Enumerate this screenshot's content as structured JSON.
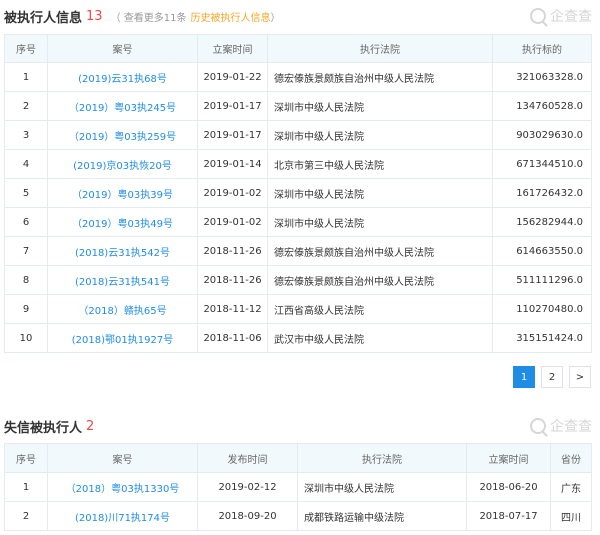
{
  "executed_section": {
    "title": "被执行人信息",
    "count": "13",
    "note_prefix": "（ 查看更多11条",
    "history_link": "历史被执行人信息",
    "note_suffix": "）",
    "watermark": "企查查",
    "headers": [
      "序号",
      "案号",
      "立案时间",
      "执行法院",
      "执行标的"
    ],
    "rows": [
      {
        "no": "1",
        "case": "(2019)云31执68号",
        "date": "2019-01-22",
        "court": "德宏傣族景颇族自治州中级人民法院",
        "amount": "321063328.0"
      },
      {
        "no": "2",
        "case": "（2019）粤03执245号",
        "date": "2019-01-17",
        "court": "深圳市中级人民法院",
        "amount": "134760528.0"
      },
      {
        "no": "3",
        "case": "（2019）粤03执259号",
        "date": "2019-01-17",
        "court": "深圳市中级人民法院",
        "amount": "903029630.0"
      },
      {
        "no": "4",
        "case": "(2019)京03执恢20号",
        "date": "2019-01-14",
        "court": "北京市第三中级人民法院",
        "amount": "671344510.0"
      },
      {
        "no": "5",
        "case": "（2019）粤03执39号",
        "date": "2019-01-02",
        "court": "深圳市中级人民法院",
        "amount": "161726432.0"
      },
      {
        "no": "6",
        "case": "（2019）粤03执49号",
        "date": "2019-01-02",
        "court": "深圳市中级人民法院",
        "amount": "156282944.0"
      },
      {
        "no": "7",
        "case": "(2018)云31执542号",
        "date": "2018-11-26",
        "court": "德宏傣族景颇族自治州中级人民法院",
        "amount": "614663550.0"
      },
      {
        "no": "8",
        "case": "(2018)云31执541号",
        "date": "2018-11-26",
        "court": "德宏傣族景颇族自治州中级人民法院",
        "amount": "511111296.0"
      },
      {
        "no": "9",
        "case": "（2018）赣执65号",
        "date": "2018-11-12",
        "court": "江西省高级人民法院",
        "amount": "110270480.0"
      },
      {
        "no": "10",
        "case": "(2018)鄂01执1927号",
        "date": "2018-11-06",
        "court": "武汉市中级人民法院",
        "amount": "315151424.0"
      }
    ]
  },
  "pagination": {
    "pages": [
      "1",
      "2"
    ],
    "current": "1",
    "next": ">"
  },
  "dishonest_section": {
    "title": "失信被执行人",
    "count": "2",
    "watermark": "企查查",
    "headers": [
      "序号",
      "案号",
      "发布时间",
      "执行法院",
      "立案时间",
      "省份"
    ],
    "rows": [
      {
        "no": "1",
        "case": "（2018）粤03执1330号",
        "publish": "2019-02-12",
        "court": "深圳市中级人民法院",
        "filed": "2018-06-20",
        "province": "广东"
      },
      {
        "no": "2",
        "case": "(2018)川71执174号",
        "publish": "2018-09-20",
        "court": "成都铁路运输中级法院",
        "filed": "2018-07-17",
        "province": "四川"
      }
    ]
  }
}
